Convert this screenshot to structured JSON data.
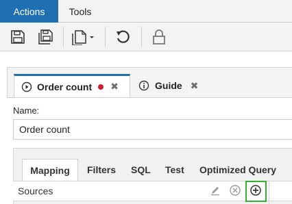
{
  "menubar": {
    "tabs": [
      {
        "label": "Actions",
        "active": true
      },
      {
        "label": "Tools",
        "active": false
      }
    ]
  },
  "toolbar": {
    "icons": [
      "save-icon",
      "save-all-icon",
      "new-document-dropdown-icon",
      "undo-icon",
      "lock-icon"
    ]
  },
  "editor": {
    "tabs": [
      {
        "label": "Order count",
        "icon": "play-circle-icon",
        "modified": true
      },
      {
        "label": "Guide",
        "icon": "info-circle-icon",
        "modified": false
      }
    ],
    "name_label": "Name:",
    "name_value": "Order count",
    "subtabs": [
      "Mapping",
      "Filters",
      "SQL",
      "Test",
      "Optimized Query"
    ],
    "active_subtab": "Mapping",
    "sources_label": "Sources"
  },
  "colors": {
    "accent": "#1f6fb2",
    "modified_dot": "#d0202e",
    "highlight_box": "#2fb430"
  }
}
